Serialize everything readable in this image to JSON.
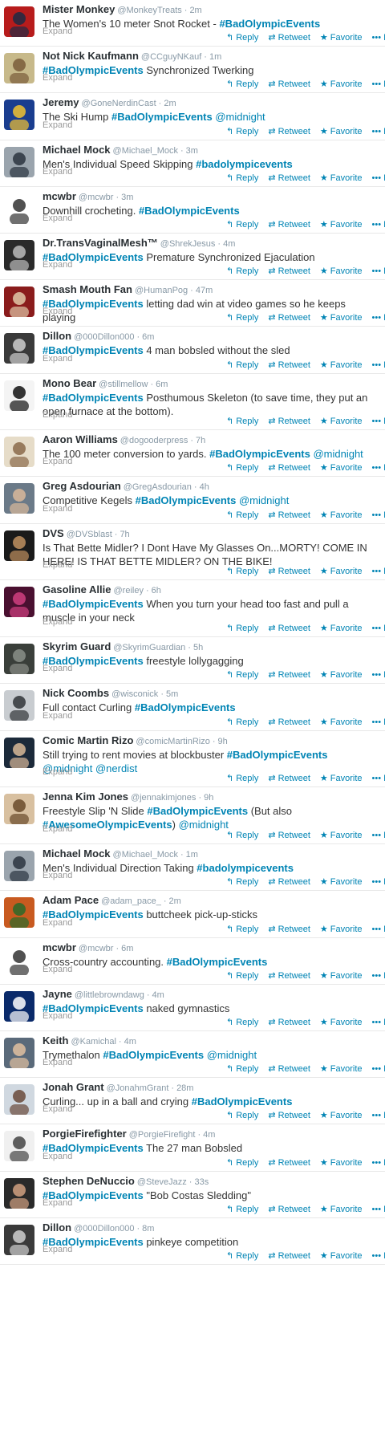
{
  "labels": {
    "expand": "Expand",
    "reply": "Reply",
    "retweet": "Retweet",
    "favorite": "Favorite",
    "more": "More"
  },
  "colors": {
    "link": "#0084b4",
    "meta": "#8899a6",
    "divider": "#e8e8e8"
  },
  "icons": {
    "reply": "reply-icon",
    "retweet": "retweet-icon",
    "favorite": "star-icon",
    "more": "ellipsis-icon"
  },
  "tweets": [
    {
      "name": "Mister Monkey",
      "handle": "@MonkeyTreats",
      "time": "2m",
      "lines": 1,
      "parts": [
        [
          "t",
          "The Women's 10 meter Snot Rocket - "
        ],
        [
          "h",
          "#BadOlympicEvents"
        ]
      ],
      "avatar": {
        "bg": "#b71c1c",
        "fg": "#1f2a44"
      }
    },
    {
      "name": "Not Nick Kaufmann",
      "handle": "@CCguyNKauf",
      "time": "1m",
      "lines": 1,
      "parts": [
        [
          "h",
          "#BadOlympicEvents"
        ],
        [
          "t",
          " Synchronized Twerking"
        ]
      ],
      "avatar": {
        "bg": "#c7b98a",
        "fg": "#7a5c3a"
      }
    },
    {
      "name": "Jeremy",
      "handle": "@GoneNerdinCast",
      "time": "2m",
      "lines": 1,
      "parts": [
        [
          "t",
          "The Ski Hump "
        ],
        [
          "h",
          "#BadOlympicEvents"
        ],
        [
          "t",
          " "
        ],
        [
          "m",
          "@midnight"
        ]
      ],
      "avatar": {
        "bg": "#1a3d8f",
        "fg": "#f2c230"
      }
    },
    {
      "name": "Michael Mock",
      "handle": "@Michael_Mock",
      "time": "3m",
      "lines": 1,
      "parts": [
        [
          "t",
          "Men's Individual Speed Skipping "
        ],
        [
          "h",
          "#badolympicevents"
        ]
      ],
      "avatar": {
        "bg": "#9aa4ad",
        "fg": "#2b3540"
      }
    },
    {
      "name": "mcwbr",
      "handle": "@mcwbr",
      "time": "3m",
      "lines": 1,
      "parts": [
        [
          "t",
          "Downhill crocheting. "
        ],
        [
          "h",
          "#BadOlympicEvents"
        ]
      ],
      "avatar": {
        "bg": "#ffffff",
        "fg": "#333333"
      }
    },
    {
      "name": "Dr.TransVaginalMesh™",
      "handle": "@ShrekJesus",
      "time": "4m",
      "lines": 1,
      "parts": [
        [
          "h",
          "#BadOlympicEvents"
        ],
        [
          "t",
          " Premature Synchronized Ejaculation"
        ]
      ],
      "avatar": {
        "bg": "#2a2a2a",
        "fg": "#bbbbbb"
      }
    },
    {
      "name": "Smash Mouth Fan",
      "handle": "@HumanPog",
      "time": "47m",
      "lines": 1,
      "parts": [
        [
          "h",
          "#BadOlympicEvents"
        ],
        [
          "t",
          " letting dad win at video games so he keeps playing"
        ]
      ],
      "avatar": {
        "bg": "#8a1c1c",
        "fg": "#e0c8a8"
      }
    },
    {
      "name": "Dillon",
      "handle": "@000Dillon000",
      "time": "6m",
      "lines": 1,
      "parts": [
        [
          "h",
          "#BadOlympicEvents"
        ],
        [
          "t",
          " 4 man bobsled without the sled"
        ]
      ],
      "avatar": {
        "bg": "#3a3a3a",
        "fg": "#cfcfcf"
      }
    },
    {
      "name": "Mono Bear",
      "handle": "@stillmellow",
      "time": "6m",
      "lines": 2,
      "parts": [
        [
          "h",
          "#BadOlympicEvents"
        ],
        [
          "t",
          " Posthumous Skeleton (to save time, they put an open furnace at the bottom)."
        ]
      ],
      "avatar": {
        "bg": "#f4f4f4",
        "fg": "#111111"
      }
    },
    {
      "name": "Aaron Williams",
      "handle": "@dogooderpress",
      "time": "7h",
      "lines": 1,
      "parts": [
        [
          "t",
          "The 100 meter conversion to yards. "
        ],
        [
          "h",
          "#BadOlympicEvents"
        ],
        [
          "t",
          " "
        ],
        [
          "m",
          "@midnight"
        ]
      ],
      "avatar": {
        "bg": "#e6dcc8",
        "fg": "#8a6a4a"
      }
    },
    {
      "name": "Greg Asdourian",
      "handle": "@GregAsdourian",
      "time": "4h",
      "lines": 1,
      "parts": [
        [
          "t",
          "Competitive Kegels "
        ],
        [
          "h",
          "#BadOlympicEvents"
        ],
        [
          "t",
          " "
        ],
        [
          "m",
          "@midnight"
        ]
      ],
      "avatar": {
        "bg": "#6b7a88",
        "fg": "#d9b99b"
      }
    },
    {
      "name": "DVS",
      "handle": "@DVSblast",
      "time": "7h",
      "lines": 2,
      "parts": [
        [
          "t",
          "Is That Bette Midler? I Dont Have My Glasses On...MORTY! COME IN HERE! IS THAT BETTE MIDLER? ON THE BIKE!"
        ]
      ],
      "avatar": {
        "bg": "#1a1a1a",
        "fg": "#c09060"
      }
    },
    {
      "name": "Gasoline Allie",
      "handle": "@reiley",
      "time": "6h",
      "lines": 2,
      "parts": [
        [
          "h",
          "#BadOlympicEvents"
        ],
        [
          "t",
          " When you turn your head too fast and pull a muscle in your neck"
        ]
      ],
      "avatar": {
        "bg": "#4a1030",
        "fg": "#d04080"
      }
    },
    {
      "name": "Skyrim Guard",
      "handle": "@SkyrimGuardian",
      "time": "5h",
      "lines": 1,
      "parts": [
        [
          "h",
          "#BadOlympicEvents"
        ],
        [
          "t",
          " freestyle lollygagging"
        ]
      ],
      "avatar": {
        "bg": "#3a3f3a",
        "fg": "#8a8f88"
      }
    },
    {
      "name": "Nick Coombs",
      "handle": "@wisconick",
      "time": "5m",
      "lines": 1,
      "parts": [
        [
          "t",
          "Full contact Curling "
        ],
        [
          "h",
          "#BadOlympicEvents"
        ]
      ],
      "avatar": {
        "bg": "#c8ccd0",
        "fg": "#303438"
      }
    },
    {
      "name": "Comic Martin Rizo",
      "handle": "@comicMartinRizo",
      "time": "9h",
      "lines": 2,
      "parts": [
        [
          "t",
          "Still trying to rent movies at blockbuster "
        ],
        [
          "h",
          "#BadOlympicEvents"
        ],
        [
          "t",
          " "
        ],
        [
          "m",
          "@midnight"
        ],
        [
          "t",
          " "
        ],
        [
          "m",
          "@nerdist"
        ]
      ],
      "avatar": {
        "bg": "#1c2a3a",
        "fg": "#d8b898"
      }
    },
    {
      "name": "Jenna Kim Jones",
      "handle": "@jennakimjones",
      "time": "9h",
      "lines": 2,
      "parts": [
        [
          "t",
          "Freestyle Slip 'N Slide "
        ],
        [
          "h",
          "#BadOlympicEvents"
        ],
        [
          "t",
          " (But also "
        ],
        [
          "h",
          "#AwesomeOlympicEvents"
        ],
        [
          "t",
          ") "
        ],
        [
          "m",
          "@midnight"
        ]
      ],
      "avatar": {
        "bg": "#d8c0a0",
        "fg": "#6a4a2a"
      }
    },
    {
      "name": "Michael Mock",
      "handle": "@Michael_Mock",
      "time": "1m",
      "lines": 1,
      "parts": [
        [
          "t",
          "Men's Individual Direction Taking "
        ],
        [
          "h",
          "#badolympicevents"
        ]
      ],
      "avatar": {
        "bg": "#9aa4ad",
        "fg": "#2b3540"
      }
    },
    {
      "name": "Adam Pace",
      "handle": "@adam_pace_",
      "time": "2m",
      "lines": 1,
      "parts": [
        [
          "h",
          "#BadOlympicEvents"
        ],
        [
          "t",
          " buttcheek pick-up-sticks"
        ]
      ],
      "avatar": {
        "bg": "#c85a20",
        "fg": "#2a6a2a"
      }
    },
    {
      "name": "mcwbr",
      "handle": "@mcwbr",
      "time": "6m",
      "lines": 1,
      "parts": [
        [
          "t",
          "Cross-country accounting. "
        ],
        [
          "h",
          "#BadOlympicEvents"
        ]
      ],
      "avatar": {
        "bg": "#ffffff",
        "fg": "#333333"
      }
    },
    {
      "name": "Jayne",
      "handle": "@littlebrowndawg",
      "time": "4m",
      "lines": 1,
      "parts": [
        [
          "h",
          "#BadOlympicEvents"
        ],
        [
          "t",
          " naked gymnastics"
        ]
      ],
      "avatar": {
        "bg": "#0a2a6a",
        "fg": "#ffffff"
      }
    },
    {
      "name": "Keith",
      "handle": "@Kamichal",
      "time": "4m",
      "lines": 1,
      "parts": [
        [
          "t",
          "Trymethalon "
        ],
        [
          "h",
          "#BadOlympicEvents"
        ],
        [
          "t",
          " "
        ],
        [
          "m",
          "@midnight"
        ]
      ],
      "avatar": {
        "bg": "#5a6a7a",
        "fg": "#e0c0a0"
      }
    },
    {
      "name": "Jonah Grant",
      "handle": "@JonahmGrant",
      "time": "28m",
      "lines": 1,
      "parts": [
        [
          "t",
          "Curling... up in a ball and crying "
        ],
        [
          "h",
          "#BadOlympicEvents"
        ]
      ],
      "avatar": {
        "bg": "#d0d8e0",
        "fg": "#6a4a3a"
      }
    },
    {
      "name": "PorgieFirefighter",
      "handle": "@PorgieFirefight",
      "time": "4m",
      "lines": 1,
      "parts": [
        [
          "h",
          "#BadOlympicEvents"
        ],
        [
          "t",
          "  The 27 man Bobsled"
        ]
      ],
      "avatar": {
        "bg": "#f0f0f0",
        "fg": "#444444"
      }
    },
    {
      "name": "Stephen DeNuccio",
      "handle": "@SteveJazz",
      "time": "33s",
      "lines": 1,
      "parts": [
        [
          "h",
          "#BadOlympicEvents"
        ],
        [
          "t",
          " \"Bob Costas Sledding\""
        ]
      ],
      "avatar": {
        "bg": "#2a2a2a",
        "fg": "#d0a080"
      }
    },
    {
      "name": "Dillon",
      "handle": "@000Dillon000",
      "time": "8m",
      "lines": 1,
      "parts": [
        [
          "h",
          "#BadOlympicEvents"
        ],
        [
          "t",
          " pinkeye competition"
        ]
      ],
      "avatar": {
        "bg": "#3a3a3a",
        "fg": "#cfcfcf"
      }
    }
  ]
}
